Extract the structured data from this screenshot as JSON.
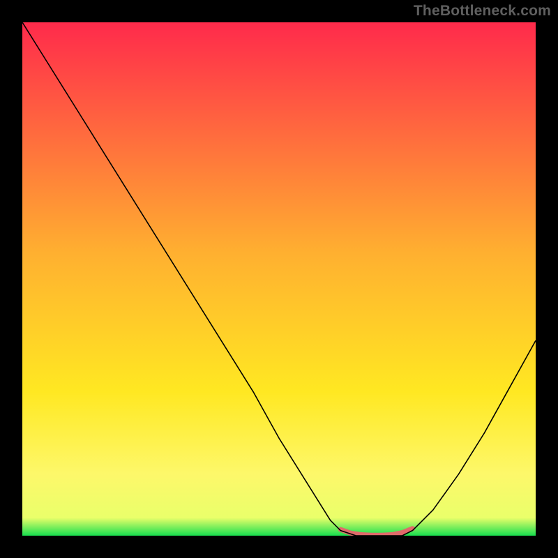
{
  "watermark": "TheBottleneck.com",
  "chart_data": {
    "type": "line",
    "title": "",
    "xlabel": "",
    "ylabel": "",
    "xlim": [
      0,
      100
    ],
    "ylim": [
      0,
      100
    ],
    "background_gradient": {
      "stops": [
        {
          "offset": 0.0,
          "color": "#ff2a4b"
        },
        {
          "offset": 0.45,
          "color": "#ffb030"
        },
        {
          "offset": 0.72,
          "color": "#ffe822"
        },
        {
          "offset": 0.88,
          "color": "#fdf86a"
        },
        {
          "offset": 0.965,
          "color": "#eaff6a"
        },
        {
          "offset": 1.0,
          "color": "#18df4f"
        }
      ]
    },
    "series": [
      {
        "name": "bottleneck-curve",
        "color": "#000000",
        "width": 1.6,
        "x": [
          0,
          5,
          10,
          15,
          20,
          25,
          30,
          35,
          40,
          45,
          50,
          55,
          60,
          62,
          65,
          70,
          74,
          76,
          80,
          85,
          90,
          95,
          100
        ],
        "y": [
          100,
          92,
          84,
          76,
          68,
          60,
          52,
          44,
          36,
          28,
          19,
          11,
          3,
          1,
          0,
          0,
          0,
          1,
          5,
          12,
          20,
          29,
          38
        ]
      }
    ],
    "highlight_segment": {
      "name": "min-region",
      "color": "#e06a6a",
      "width": 7,
      "x": [
        62,
        64,
        66,
        68,
        70,
        72,
        74,
        76
      ],
      "y": [
        1.2,
        0.5,
        0.2,
        0.1,
        0.1,
        0.2,
        0.6,
        1.4
      ]
    }
  }
}
